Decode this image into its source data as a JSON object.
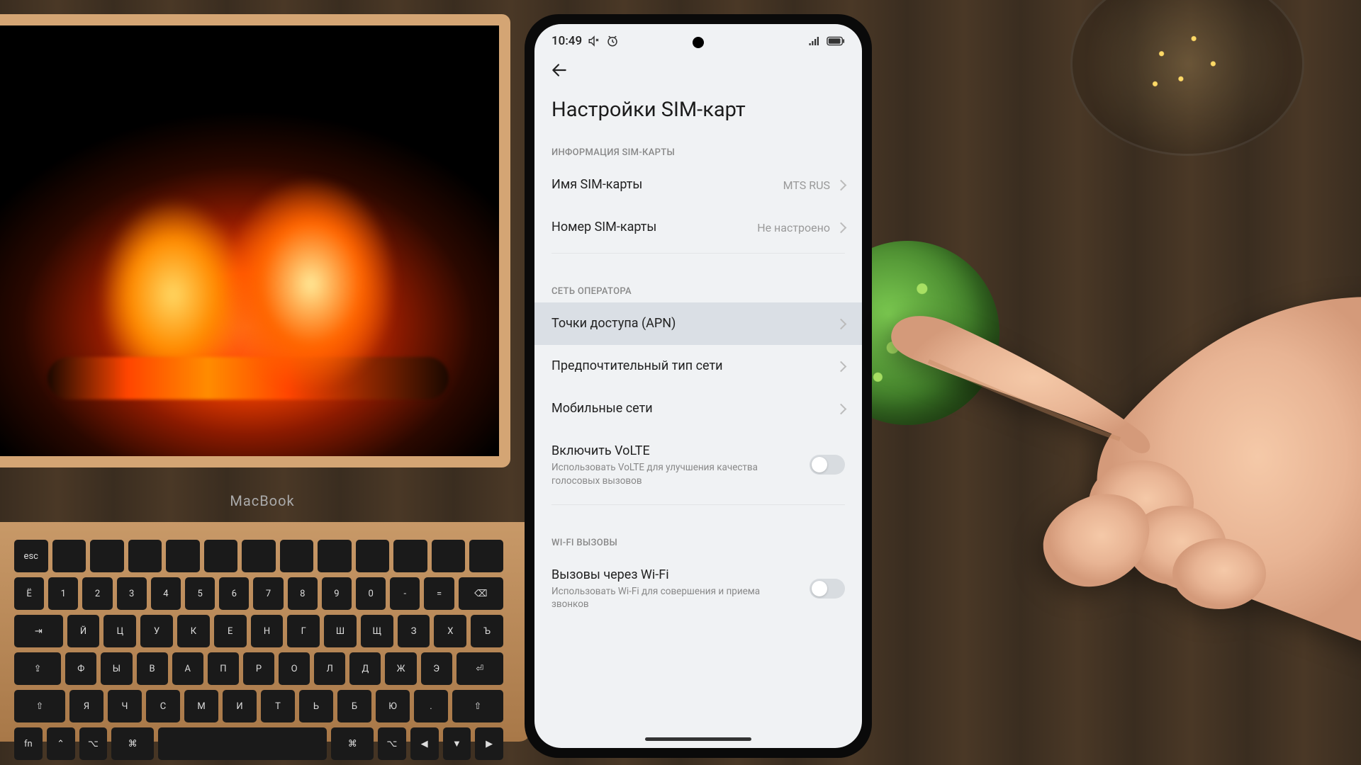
{
  "statusbar": {
    "time": "10:49"
  },
  "page": {
    "title": "Настройки SIM-карт"
  },
  "sections": {
    "sim_info": {
      "header": "ИНФОРМАЦИЯ SIM-КАРТЫ",
      "name_label": "Имя SIM-карты",
      "name_value": "MTS RUS",
      "number_label": "Номер SIM-карты",
      "number_value": "Не настроено"
    },
    "carrier": {
      "header": "СЕТЬ ОПЕРАТОРА",
      "apn_label": "Точки доступа (APN)",
      "nettype_label": "Предпочтительный тип сети",
      "mobile_label": "Мобильные сети",
      "volte_label": "Включить VoLTE",
      "volte_sub": "Использовать VoLTE для улучшения качества голосовых вызовов"
    },
    "wifi_calls": {
      "header": "WI-FI ВЫЗОВЫ",
      "wificall_label": "Вызовы через Wi-Fi",
      "wificall_sub": "Использовать Wi-Fi для совершения и приема звонков"
    }
  },
  "laptop": {
    "brand": "MacBook"
  }
}
